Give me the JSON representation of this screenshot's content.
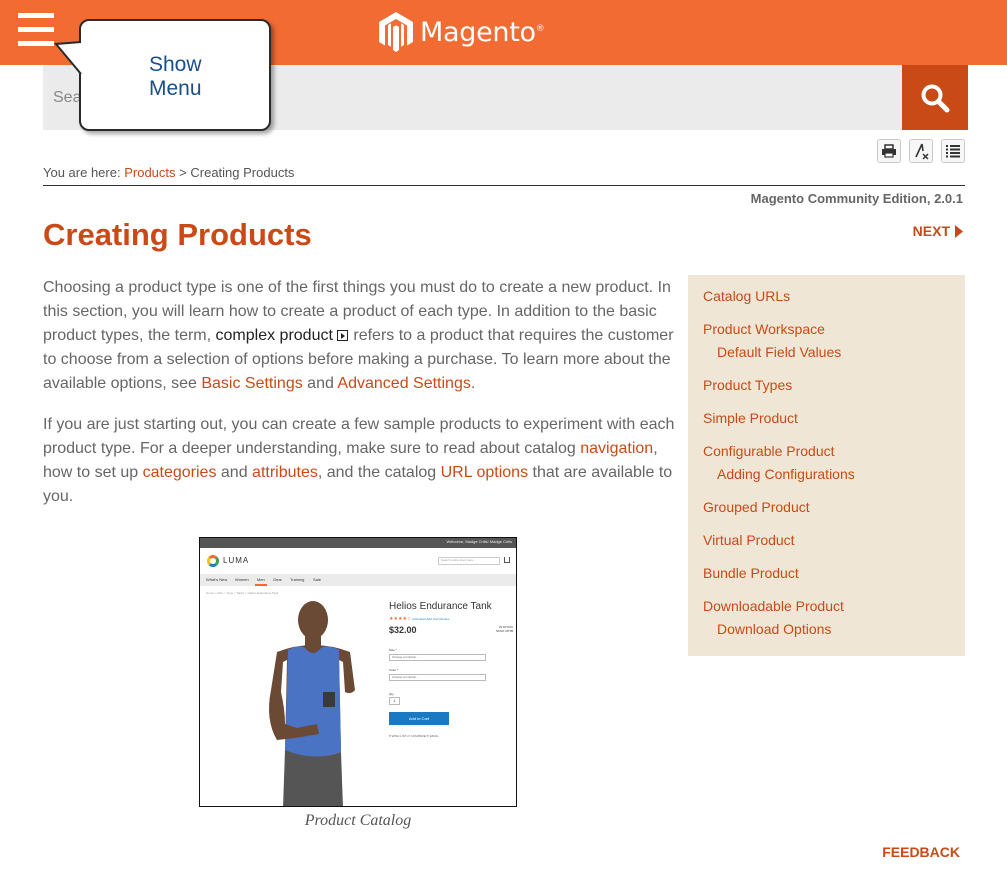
{
  "header": {
    "brand": "Magento",
    "trademark": "®",
    "brand_color": "#f26b33",
    "menu_icon": "hamburger-menu-icon"
  },
  "search": {
    "placeholder": "Search",
    "button_icon": "search-icon",
    "button_color": "#c94a17"
  },
  "tooltip": {
    "text_line1": "Show",
    "text_line2": "Menu"
  },
  "toolbar": {
    "print_icon": "print-icon",
    "clear_highlight_icon": "clear-highlight-icon",
    "toc_icon": "list-icon"
  },
  "breadcrumb": {
    "prefix": "You are here:",
    "link": "Products",
    "separator": ">",
    "current": "Creating Products"
  },
  "edition": "Magento Community Edition, 2.0.1",
  "page": {
    "title": "Creating Products",
    "next_label": "NEXT"
  },
  "content": {
    "p1_a": "Choosing a product type is one of the first things you must do to create a new product. In this section, you will learn how to create a product of each type. In addition to the basic product types, the term, ",
    "p1_term": "complex product",
    "p1_b": " refers to a product that requires the customer to choose from a selection of options before making a purchase. To learn more about the available options, see ",
    "p1_link1": "Basic Settings",
    "p1_c": " and ",
    "p1_link2": "Advanced Settings",
    "p1_d": ".",
    "p2_a": "If you are just starting out, you can create a few sample products to experiment with each product type. For a deeper understanding, make sure to read about catalog ",
    "p2_link1": "navigation",
    "p2_b": ", how to set up ",
    "p2_link2": "categories",
    "p2_c": " and ",
    "p2_link3": "attributes",
    "p2_d": ", and the catalog ",
    "p2_link4": "URL options",
    "p2_e": " that are available to you."
  },
  "sidebar": {
    "items": [
      {
        "label": "Catalog URLs"
      },
      {
        "label": "Product Workspace"
      },
      {
        "label": "Default Field Values"
      },
      {
        "label": "Product Types"
      },
      {
        "label": "Simple Product"
      },
      {
        "label": "Configurable Product"
      },
      {
        "label": "Adding Configurations"
      },
      {
        "label": "Grouped Product"
      },
      {
        "label": "Virtual Product"
      },
      {
        "label": "Bundle Product"
      },
      {
        "label": "Downloadable Product"
      },
      {
        "label": "Download Options"
      }
    ]
  },
  "figure": {
    "caption": "Product Catalog",
    "mini": {
      "top_text": "Welcome, Madge Crilis!   Madge Crilis",
      "brand": "LUMA",
      "search_placeholder": "Search entire store here...",
      "nav": [
        "What's New",
        "Women",
        "Men",
        "Gear",
        "Training",
        "Sale"
      ],
      "crumbs": "Home  >  Men  >  Tops  >  Tanks  >  Helios Endurance Tank",
      "product_name": "Helios Endurance Tank",
      "stars": "★★★★☆",
      "reviews": "3 Reviews    Add Your Review",
      "price": "$32.00",
      "stock": "IN STOCK",
      "sku": "SKU#: MT05",
      "size_label": "Size *",
      "size_value": "Choose an Option...",
      "color_label": "Color *",
      "color_value": "Choose an Option...",
      "qty_label": "Qty",
      "qty_value": "1",
      "add_label": "Add to Cart",
      "actions": "♥ WISH LIST      ⇄ COMPARE      ✉ EMAIL"
    }
  },
  "footer": {
    "feedback": "FEEDBACK"
  }
}
